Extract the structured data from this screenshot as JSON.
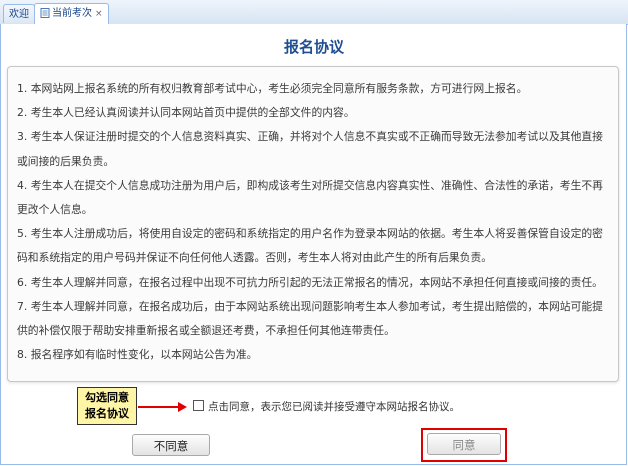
{
  "tabs": [
    {
      "label": "欢迎",
      "active": false
    },
    {
      "label": "当前考次",
      "active": true,
      "close": "×"
    }
  ],
  "title": "报名协议",
  "agreement": [
    "1. 本网站网上报名系统的所有权归教育部考试中心，考生必须完全同意所有服务条款，方可进行网上报名。",
    "2. 考生本人已经认真阅读并认同本网站首页中提供的全部文件的内容。",
    "3. 考生本人保证注册时提交的个人信息资料真实、正确，并将对个人信息不真实或不正确而导致无法参加考试以及其他直接或间接的后果负责。",
    "4. 考生本人在提交个人信息成功注册为用户后，即构成该考生对所提交信息内容真实性、准确性、合法性的承诺，考生不再更改个人信息。",
    "5. 考生本人注册成功后，将使用自设定的密码和系统指定的用户名作为登录本网站的依据。考生本人将妥善保管自设定的密码和系统指定的用户号码并保证不向任何他人透露。否则，考生本人将对由此产生的所有后果负责。",
    "6. 考生本人理解并同意，在报名过程中出现不可抗力所引起的无法正常报名的情况，本网站不承担任何直接或间接的责任。",
    "7. 考生本人理解并同意，在报名成功后，由于本网站系统出现问题影响考生本人参加考试，考生提出赔偿的，本网站可能提供的补偿仅限于帮助安排重新报名或全额退还考费，不承担任何其他连带责任。",
    "8. 报名程序如有临时性变化，以本网站公告为准。"
  ],
  "callout": {
    "line1": "勾选同意",
    "line2": "报名协议"
  },
  "agree_text": "点击同意，表示您已阅读并接受遵守本网站报名协议。",
  "buttons": {
    "disagree": "不同意",
    "agree": "同意"
  },
  "colors": {
    "title": "#1f4e92",
    "highlight": "#e00000",
    "callout_bg": "#fff5a7"
  }
}
